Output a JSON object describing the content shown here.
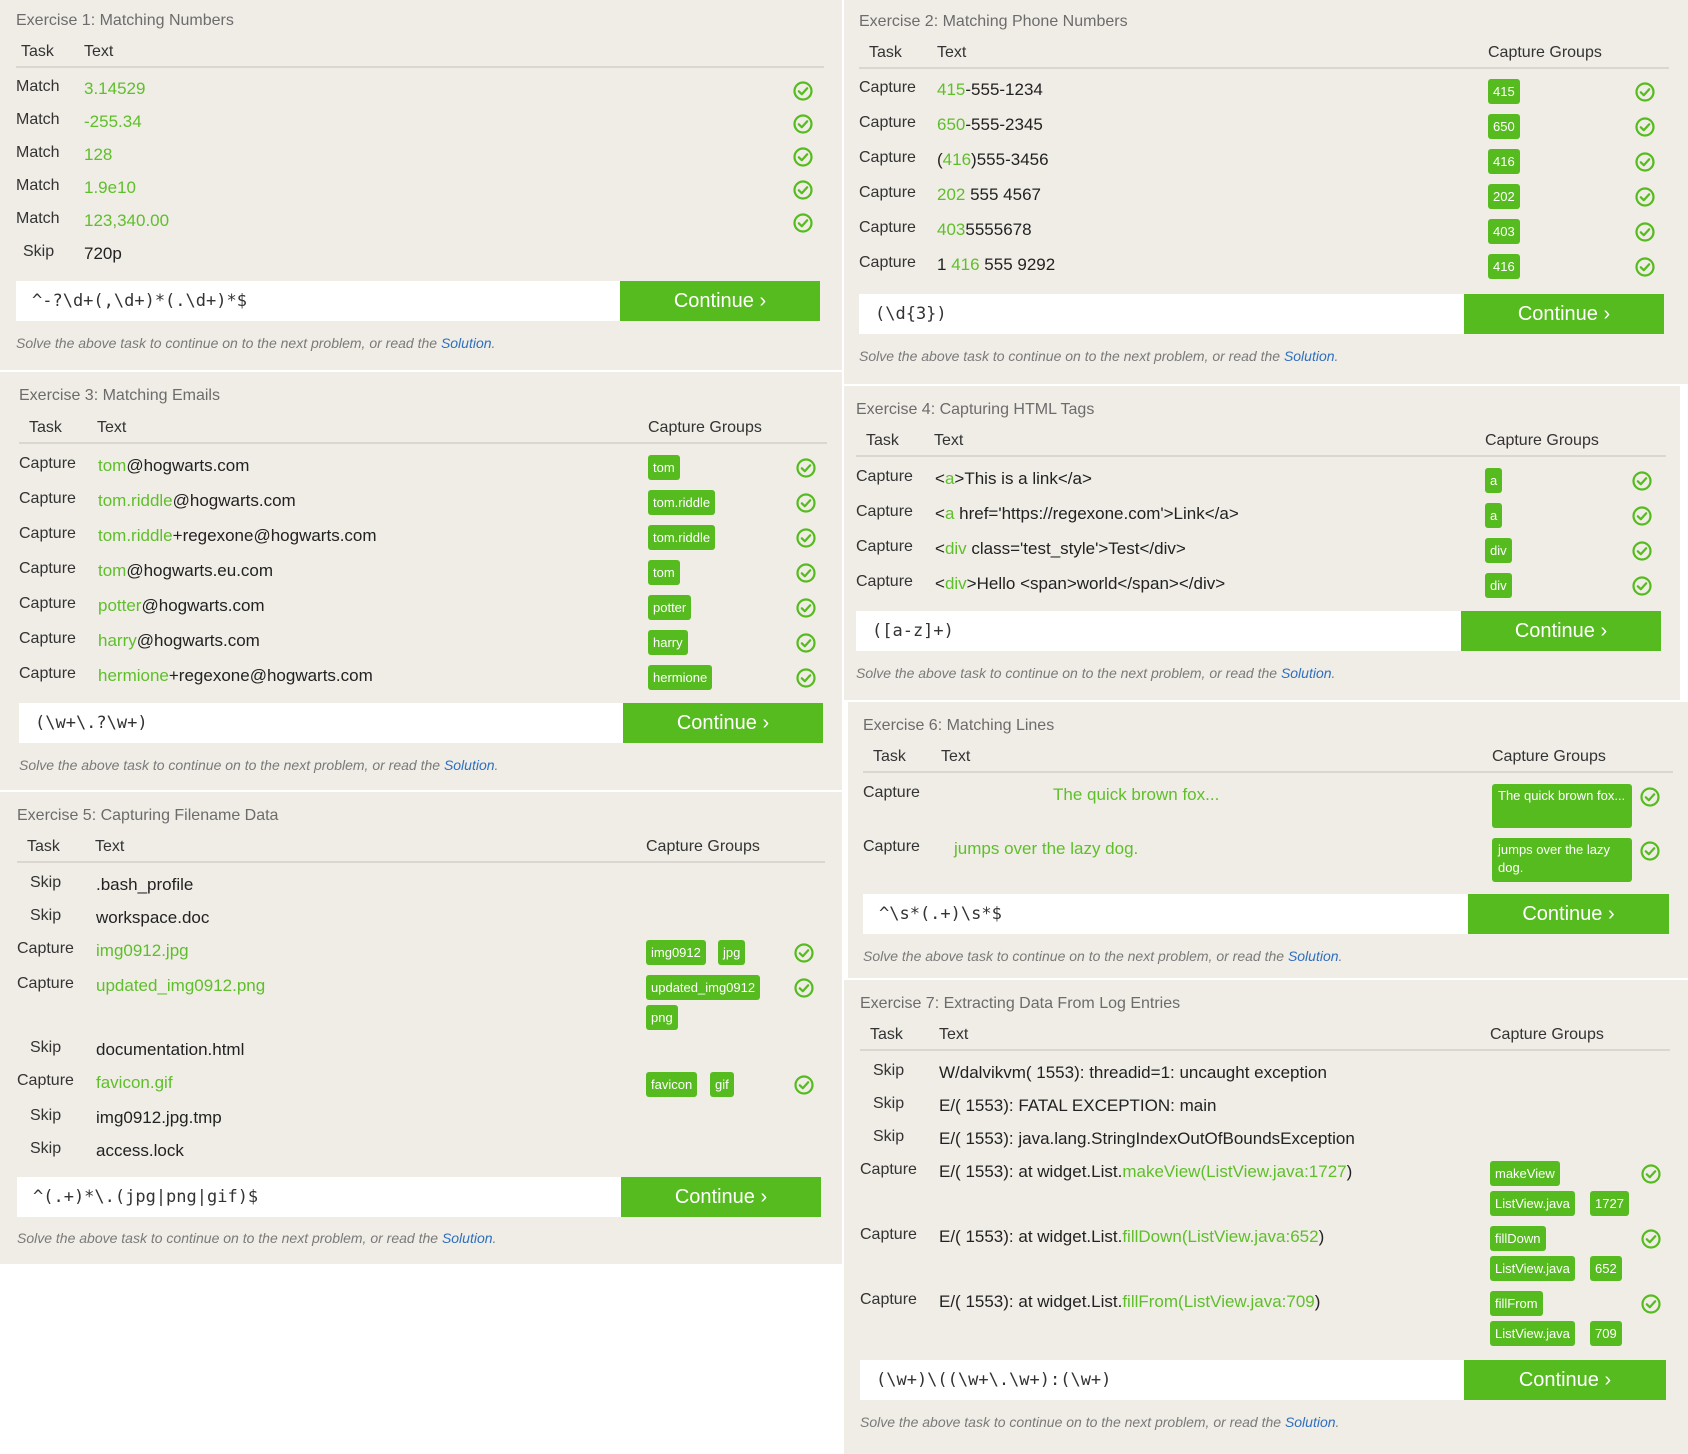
{
  "common": {
    "continue_label": "Continue ›",
    "hint_prefix": "Solve the above task to continue on to the next problem, or read the ",
    "solution_link": "Solution",
    "hint_suffix": ".",
    "col_task": "Task",
    "col_text": "Text",
    "col_groups": "Capture Groups",
    "icon": "check-circle-icon",
    "accent": "#56bb1e",
    "link_color": "#2f6fbf"
  },
  "exercises": [
    {
      "title": "Exercise 1: Matching Numbers",
      "input": "^-?\\d+(,\\d+)*(.\\d+)*$",
      "rows": [
        {
          "task": "Match",
          "text": "3.14529",
          "hi": "all"
        },
        {
          "task": "Match",
          "text": "-255.34",
          "hi": "all"
        },
        {
          "task": "Match",
          "text": "128",
          "hi": "all"
        },
        {
          "task": "Match",
          "text": "1.9e10",
          "hi": "all"
        },
        {
          "task": "Match",
          "text": "123,340.00",
          "hi": "all"
        },
        {
          "task": "Skip",
          "text": "720p"
        }
      ]
    },
    {
      "title": "Exercise 2: Matching Phone Numbers",
      "input": "(\\d{3})",
      "rows": [
        {
          "task": "Capture",
          "pre": "",
          "g": "415",
          "post": "-555-1234",
          "groups": [
            "415"
          ]
        },
        {
          "task": "Capture",
          "pre": "",
          "g": "650",
          "post": "-555-2345",
          "groups": [
            "650"
          ]
        },
        {
          "task": "Capture",
          "pre": "(",
          "g": "416",
          "post": ")555-3456",
          "groups": [
            "416"
          ]
        },
        {
          "task": "Capture",
          "pre": "",
          "g": "202",
          "post": " 555 4567",
          "groups": [
            "202"
          ]
        },
        {
          "task": "Capture",
          "pre": "",
          "g": "403",
          "post": "5555678",
          "groups": [
            "403"
          ]
        },
        {
          "task": "Capture",
          "pre": "1 ",
          "g": "416",
          "post": " 555 9292",
          "groups": [
            "416"
          ]
        }
      ]
    },
    {
      "title": "Exercise 3: Matching Emails",
      "input": "(\\w+\\.?\\w+)",
      "rows": [
        {
          "task": "Capture",
          "pre": "",
          "g": "tom",
          "post": "@hogwarts.com",
          "groups": [
            "tom"
          ]
        },
        {
          "task": "Capture",
          "pre": "",
          "g": "tom.riddle",
          "post": "@hogwarts.com",
          "groups": [
            "tom.riddle"
          ]
        },
        {
          "task": "Capture",
          "pre": "",
          "g": "tom.riddle",
          "post": "+regexone@hogwarts.com",
          "groups": [
            "tom.riddle"
          ]
        },
        {
          "task": "Capture",
          "pre": "",
          "g": "tom",
          "post": "@hogwarts.eu.com",
          "groups": [
            "tom"
          ]
        },
        {
          "task": "Capture",
          "pre": "",
          "g": "potter",
          "post": "@hogwarts.com",
          "groups": [
            "potter"
          ]
        },
        {
          "task": "Capture",
          "pre": "",
          "g": "harry",
          "post": "@hogwarts.com",
          "groups": [
            "harry"
          ]
        },
        {
          "task": "Capture",
          "pre": "",
          "g": "hermione",
          "post": "+regexone@hogwarts.com",
          "groups": [
            "hermione"
          ]
        }
      ]
    },
    {
      "title": "Exercise 4: Capturing HTML Tags",
      "input": "([a-z]+)",
      "rows": [
        {
          "task": "Capture",
          "pre": "<",
          "g": "a",
          "post": ">This is a link</a>",
          "groups": [
            "a"
          ]
        },
        {
          "task": "Capture",
          "pre": "<",
          "g": "a",
          "post": " href='https://regexone.com'>Link</a>",
          "groups": [
            "a"
          ]
        },
        {
          "task": "Capture",
          "pre": "<",
          "g": "div",
          "post": " class='test_style'>Test</div>",
          "groups": [
            "div"
          ]
        },
        {
          "task": "Capture",
          "pre": "<",
          "g": "div",
          "post": ">Hello <span>world</span></div>",
          "groups": [
            "div"
          ]
        }
      ]
    },
    {
      "title": "Exercise 5: Capturing Filename Data",
      "input": "^(.+)*\\.(jpg|png|gif)$",
      "rows": [
        {
          "task": "Skip",
          "text": ".bash_profile"
        },
        {
          "task": "Skip",
          "text": "workspace.doc"
        },
        {
          "task": "Capture",
          "pre": "",
          "g": "img0912.jpg",
          "post": "",
          "groups": [
            "img0912",
            "jpg"
          ]
        },
        {
          "task": "Capture",
          "pre": "",
          "g": "updated_img0912.png",
          "post": "",
          "groups": [
            "updated_img0912",
            "png"
          ]
        },
        {
          "task": "Skip",
          "text": "documentation.html"
        },
        {
          "task": "Capture",
          "pre": "",
          "g": "favicon.gif",
          "post": "",
          "groups": [
            "favicon",
            "gif"
          ]
        },
        {
          "task": "Skip",
          "text": "img0912.jpg.tmp"
        },
        {
          "task": "Skip",
          "text": "access.lock"
        }
      ]
    },
    {
      "title": "Exercise 6: Matching Lines",
      "input": "^\\s*(.+)\\s*$",
      "rows": [
        {
          "task": "Capture",
          "pre": "",
          "g": "The quick brown fox...",
          "post": "",
          "groups": [
            "The quick brown fox..."
          ]
        },
        {
          "task": "Capture",
          "pre": "",
          "g": "jumps over the lazy dog.",
          "post": "",
          "groups": [
            "jumps over the lazy dog."
          ]
        }
      ]
    },
    {
      "title": "Exercise 7: Extracting Data From Log Entries",
      "input": "(\\w+)\\((\\w+\\.\\w+):(\\w+)",
      "rows": [
        {
          "task": "Skip",
          "text": "W/dalvikvm( 1553): threadid=1: uncaught exception"
        },
        {
          "task": "Skip",
          "text": "E/( 1553): FATAL EXCEPTION: main"
        },
        {
          "task": "Skip",
          "text": "E/( 1553): java.lang.StringIndexOutOfBoundsException"
        },
        {
          "task": "Capture",
          "pre": "E/( 1553):   at widget.List.",
          "g": "makeView(ListView.java:1727",
          "post": ")",
          "groups": [
            "makeView",
            "ListView.java",
            "1727"
          ]
        },
        {
          "task": "Capture",
          "pre": "E/( 1553):   at widget.List.",
          "g": "fillDown(ListView.java:652",
          "post": ")",
          "groups": [
            "fillDown",
            "ListView.java",
            "652"
          ]
        },
        {
          "task": "Capture",
          "pre": "E/( 1553):   at widget.List.",
          "g": "fillFrom(ListView.java:709",
          "post": ")",
          "groups": [
            "fillFrom",
            "ListView.java",
            "709"
          ]
        }
      ]
    }
  ]
}
